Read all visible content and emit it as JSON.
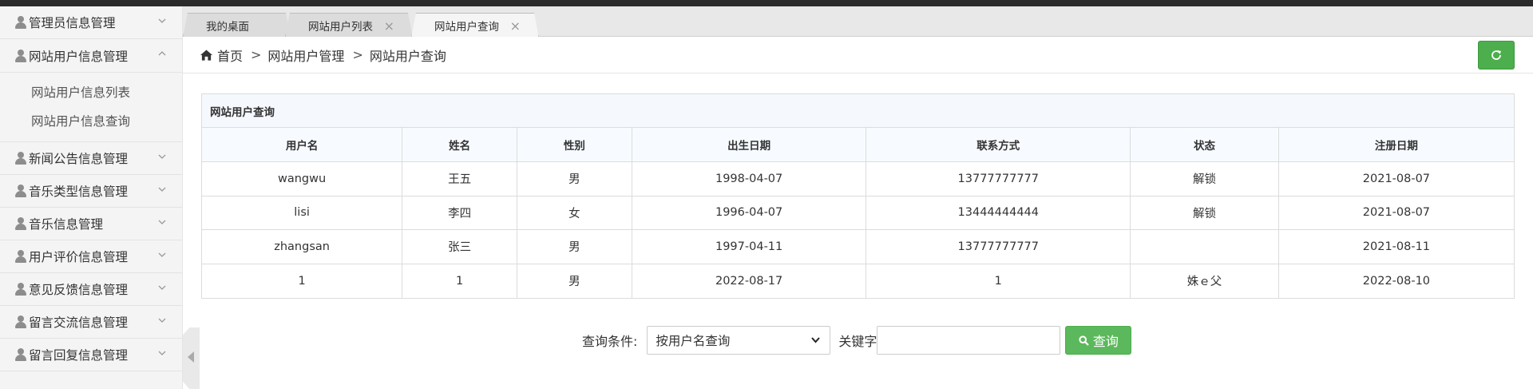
{
  "sidebar": {
    "items": [
      {
        "label": "管理员信息管理",
        "expanded": false
      },
      {
        "label": "网站用户信息管理",
        "expanded": true,
        "children": [
          "网站用户信息列表",
          "网站用户信息查询"
        ]
      },
      {
        "label": "新闻公告信息管理",
        "expanded": false
      },
      {
        "label": "音乐类型信息管理",
        "expanded": false
      },
      {
        "label": "音乐信息管理",
        "expanded": false
      },
      {
        "label": "用户评价信息管理",
        "expanded": false
      },
      {
        "label": "意见反馈信息管理",
        "expanded": false
      },
      {
        "label": "留言交流信息管理",
        "expanded": false
      },
      {
        "label": "留言回复信息管理",
        "expanded": false
      }
    ]
  },
  "tabs": [
    {
      "label": "我的桌面",
      "closable": false,
      "active": false
    },
    {
      "label": "网站用户列表",
      "closable": true,
      "active": false
    },
    {
      "label": "网站用户查询",
      "closable": true,
      "active": true
    }
  ],
  "breadcrumb": {
    "home": "首页",
    "sep": ">",
    "level1": "网站用户管理",
    "level2": "网站用户查询"
  },
  "panel": {
    "title": "网站用户查询",
    "columns": [
      "用户名",
      "姓名",
      "性别",
      "出生日期",
      "联系方式",
      "状态",
      "注册日期"
    ],
    "rows": [
      [
        "wangwu",
        "王五",
        "男",
        "1998-04-07",
        "13777777777",
        "解锁",
        "2021-08-07"
      ],
      [
        "lisi",
        "李四",
        "女",
        "1996-04-07",
        "13444444444",
        "解锁",
        "2021-08-07"
      ],
      [
        "zhangsan",
        "张三",
        "男",
        "1997-04-11",
        "13777777777",
        "",
        "2021-08-11"
      ],
      [
        "1",
        "1",
        "男",
        "2022-08-17",
        "1",
        "姝ｅ父",
        "2022-08-10"
      ]
    ]
  },
  "search": {
    "condition_label": "查询条件:",
    "selected_option": "按用户名查询",
    "keyword_label": "关键字",
    "keyword_value": "",
    "button_label": "查询"
  },
  "colors": {
    "primary_green": "#5cb85c",
    "topbar": "#2b2b2b",
    "icon_gray": "#8d8d8d"
  }
}
